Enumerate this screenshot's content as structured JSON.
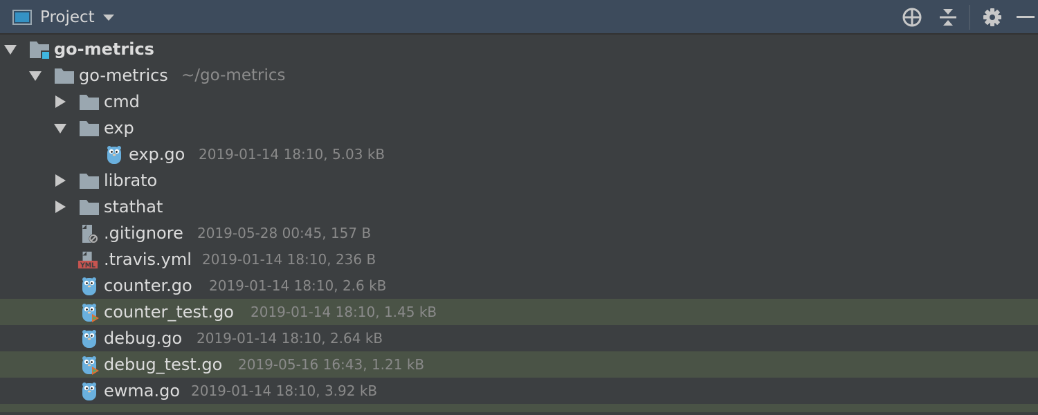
{
  "header": {
    "title": "Project",
    "icons": [
      "panel-icon",
      "dropdown-caret-icon",
      "locate-icon",
      "collapse-all-icon",
      "gear-icon",
      "minimize-icon"
    ]
  },
  "colors": {
    "header_bg": "#3d4b5c",
    "tree_bg": "#3c3f41",
    "changed_row_bg": "#4a5346",
    "gopher_blue": "#6ab0de",
    "text": "#dcdcdc",
    "meta_text": "#8a8a8a"
  },
  "tree": {
    "root": {
      "label": "go-metrics",
      "icon": "project-module-icon",
      "expanded": true
    },
    "module": {
      "label": "go-metrics",
      "path": "~/go-metrics",
      "icon": "folder-icon",
      "expanded": true
    },
    "cmd": {
      "label": "cmd",
      "icon": "folder-icon",
      "expanded": false
    },
    "exp": {
      "label": "exp",
      "icon": "folder-icon",
      "expanded": true
    },
    "exp_go": {
      "label": "exp.go",
      "meta": "2019-01-14 18:10, 5.03 kB",
      "icon": "go-file-icon"
    },
    "librato": {
      "label": "librato",
      "icon": "folder-icon",
      "expanded": false
    },
    "stathat": {
      "label": "stathat",
      "icon": "folder-icon",
      "expanded": false
    },
    "gitignore": {
      "label": ".gitignore",
      "meta": "2019-05-28 00:45, 157 B",
      "icon": "gitignore-file-icon"
    },
    "travis": {
      "label": ".travis.yml",
      "meta": "2019-01-14 18:10, 236 B",
      "icon": "yml-file-icon",
      "badge": "YML"
    },
    "counter": {
      "label": "counter.go",
      "meta": "2019-01-14 18:10, 2.6 kB",
      "icon": "go-file-icon"
    },
    "counter_test": {
      "label": "counter_test.go",
      "meta": "2019-01-14 18:10, 1.45 kB",
      "icon": "go-test-file-icon"
    },
    "debug": {
      "label": "debug.go",
      "meta": "2019-01-14 18:10, 2.64 kB",
      "icon": "go-file-icon"
    },
    "debug_test": {
      "label": "debug_test.go",
      "meta": "2019-05-16 16:43, 1.21 kB",
      "icon": "go-test-file-icon"
    },
    "ewma": {
      "label": "ewma.go",
      "meta": "2019-01-14 18:10, 3.92 kB",
      "icon": "go-file-icon"
    }
  }
}
